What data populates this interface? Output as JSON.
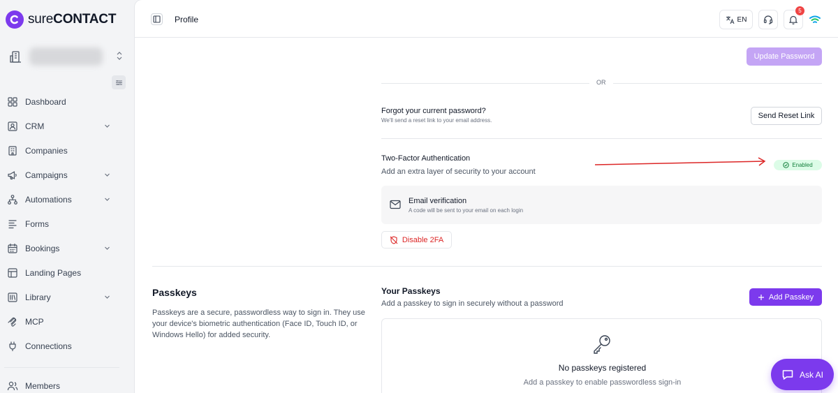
{
  "brand": {
    "prefix": "sure",
    "suffix": "CONTACT"
  },
  "sidebar": {
    "items": [
      {
        "label": "Dashboard",
        "icon": "dashboard-icon",
        "has_chevron": false
      },
      {
        "label": "CRM",
        "icon": "crm-icon",
        "has_chevron": true
      },
      {
        "label": "Companies",
        "icon": "building-icon",
        "has_chevron": false
      },
      {
        "label": "Campaigns",
        "icon": "megaphone-icon",
        "has_chevron": true
      },
      {
        "label": "Automations",
        "icon": "workflow-icon",
        "has_chevron": true
      },
      {
        "label": "Forms",
        "icon": "form-icon",
        "has_chevron": false
      },
      {
        "label": "Bookings",
        "icon": "calendar-icon",
        "has_chevron": true
      },
      {
        "label": "Landing Pages",
        "icon": "layout-icon",
        "has_chevron": false
      },
      {
        "label": "Library",
        "icon": "library-icon",
        "has_chevron": true
      },
      {
        "label": "MCP",
        "icon": "mcp-icon",
        "has_chevron": false
      },
      {
        "label": "Connections",
        "icon": "plug-icon",
        "has_chevron": false
      }
    ],
    "members_label": "Members"
  },
  "topbar": {
    "title": "Profile",
    "lang": "EN",
    "notification_count": "5"
  },
  "password": {
    "update_button": "Update Password",
    "or_text": "OR",
    "forgot_title": "Forgot your current password?",
    "forgot_desc": "We'll send a reset link to your email address.",
    "reset_button": "Send Reset Link"
  },
  "two_factor": {
    "title": "Two-Factor Authentication",
    "desc": "Add an extra layer of security to your account",
    "status": "Enabled",
    "method_title": "Email verification",
    "method_desc": "A code will be sent to your email on each login",
    "disable_button": "Disable 2FA"
  },
  "passkeys": {
    "title": "Passkeys",
    "desc": "Passkeys are a secure, passwordless way to sign in. They use your device's biometric authentication (Face ID, Touch ID, or Windows Hello) for added security.",
    "your_title": "Your Passkeys",
    "your_desc": "Add a passkey to sign in securely without a password",
    "add_button": "Add Passkey",
    "empty_title": "No passkeys registered",
    "empty_desc": "Add a passkey to enable passwordless sign-in"
  },
  "ask_ai": "Ask AI",
  "colors": {
    "accent": "#7c3aed",
    "success": "#15803d",
    "danger": "#dc2626",
    "annotation_arrow": "#dc2626"
  }
}
